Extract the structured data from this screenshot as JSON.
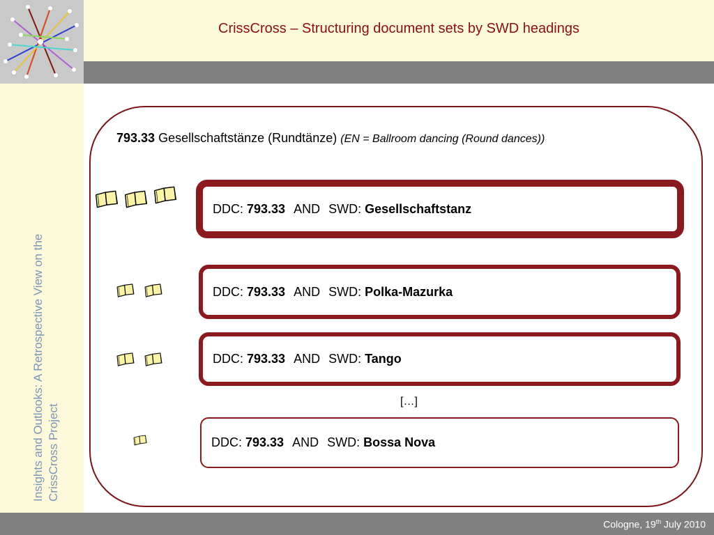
{
  "slide": {
    "title": "CrissCross – Structuring document sets by SWD headings",
    "side_caption": "Insights and Outlooks: A Retrospective View on the CrissCross Project",
    "footer": {
      "place": "Cologne, 19",
      "ordinal": "th",
      "date_rest": " July 2010"
    }
  },
  "heading": {
    "code": "793.33",
    "label": "Gesellschaftstänze (Rundtänze)",
    "translation": "(EN = Ballroom dancing (Round dances))"
  },
  "queries": [
    {
      "ddc_label": "DDC:",
      "ddc_code": "793.33",
      "operator": "AND",
      "swd_label": "SWD:",
      "swd_term": "Gesellschaftstanz"
    },
    {
      "ddc_label": "DDC:",
      "ddc_code": "793.33",
      "operator": "AND",
      "swd_label": "SWD:",
      "swd_term": "Polka-Mazurka"
    },
    {
      "ddc_label": "DDC:",
      "ddc_code": "793.33",
      "operator": "AND",
      "swd_label": "SWD:",
      "swd_term": "Tango"
    },
    {
      "ddc_label": "DDC:",
      "ddc_code": "793.33",
      "operator": "AND",
      "swd_label": "SWD:",
      "swd_term": "Bossa Nova"
    }
  ],
  "book_counts": [
    3,
    2,
    2,
    1
  ],
  "ellipsis": "[…]",
  "colors": {
    "accent_red": "#8b0e12",
    "cream": "#fdfadb",
    "gray_bar": "#808080",
    "book_fill": "#fbf4a6"
  }
}
